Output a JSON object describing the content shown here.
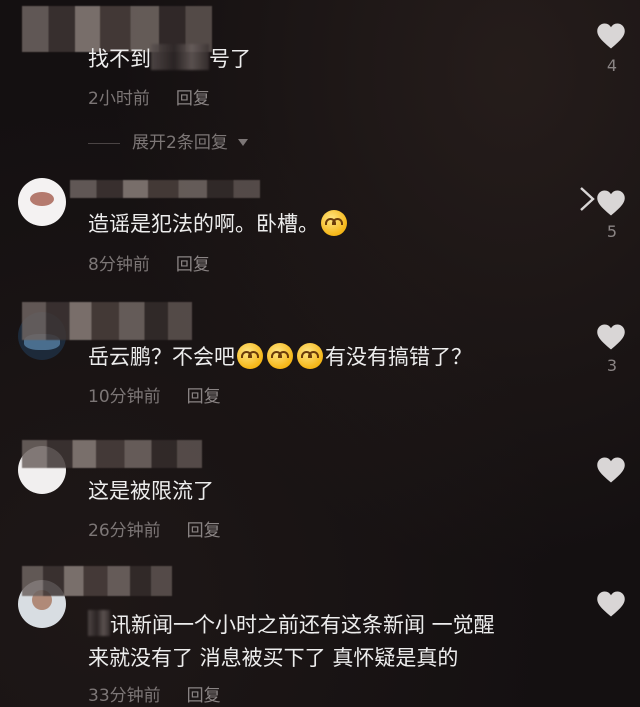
{
  "comments": [
    {
      "text_before": "找不到",
      "text_after": "号了",
      "time": "2小时前",
      "reply": "回复",
      "likes": "4",
      "expand": "展开2条回复"
    },
    {
      "text": "造谣是犯法的啊。卧槽。",
      "time": "8分钟前",
      "reply": "回复",
      "likes": "5"
    },
    {
      "text_before": "岳云鹏？不会吧",
      "text_after": "有没有搞错了？",
      "time": "10分钟前",
      "reply": "回复",
      "likes": "3"
    },
    {
      "text": "这是被限流了",
      "time": "26分钟前",
      "reply": "回复",
      "likes": ""
    },
    {
      "line1": "讯新闻一个小时之前还有这条新闻 一觉醒",
      "line2": "来就没有了 消息被买下了 真怀疑是真的",
      "time": "33分钟前",
      "reply": "回复",
      "likes": ""
    }
  ],
  "icons": {
    "heart": "heart-icon",
    "chevron": "chevron-right-icon",
    "expand_arrow": "triangle-down-icon"
  },
  "colors": {
    "background": "#141011",
    "text": "#ededed",
    "meta": "#7c7676",
    "heart": "#d9d6d6"
  }
}
